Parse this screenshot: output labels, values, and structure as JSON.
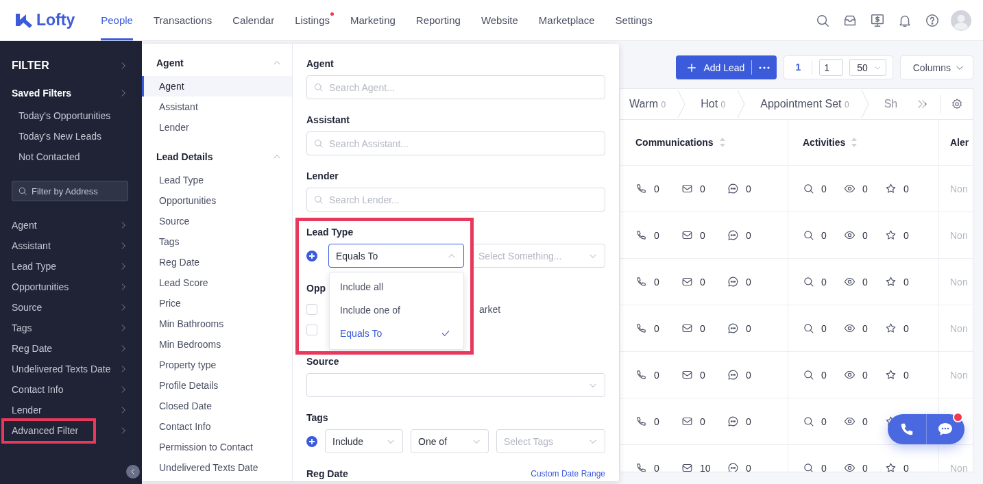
{
  "nav": {
    "logo": "Lofty",
    "items": [
      {
        "label": "People",
        "selected": true,
        "dot": false
      },
      {
        "label": "Transactions",
        "selected": false,
        "dot": false
      },
      {
        "label": "Calendar",
        "selected": false,
        "dot": false
      },
      {
        "label": "Listings",
        "selected": false,
        "dot": true
      },
      {
        "label": "Marketing",
        "selected": false,
        "dot": false
      },
      {
        "label": "Reporting",
        "selected": false,
        "dot": false
      },
      {
        "label": "Website",
        "selected": false,
        "dot": false
      },
      {
        "label": "Marketplace",
        "selected": false,
        "dot": false
      },
      {
        "label": "Settings",
        "selected": false,
        "dot": false
      }
    ]
  },
  "sidebar": {
    "title": "FILTER",
    "saved_filters": {
      "title": "Saved Filters",
      "items": [
        "Today's Opportunities",
        "Today's New Leads",
        "Not Contacted"
      ]
    },
    "address_search": {
      "placeholder": "Filter by Address"
    },
    "items": [
      {
        "label": "Agent",
        "highlighted": false
      },
      {
        "label": "Assistant",
        "highlighted": false
      },
      {
        "label": "Lead Type",
        "highlighted": false
      },
      {
        "label": "Opportunities",
        "highlighted": false
      },
      {
        "label": "Source",
        "highlighted": false
      },
      {
        "label": "Tags",
        "highlighted": false
      },
      {
        "label": "Reg Date",
        "highlighted": false
      },
      {
        "label": "Undelivered Texts Date",
        "highlighted": false
      },
      {
        "label": "Contact Info",
        "highlighted": false
      },
      {
        "label": "Lender",
        "highlighted": false
      },
      {
        "label": "Advanced Filter",
        "highlighted": true
      }
    ]
  },
  "filter_categories": [
    {
      "title": "Agent",
      "expanded": true,
      "items": [
        {
          "label": "Agent",
          "selected": true
        },
        {
          "label": "Assistant",
          "selected": false
        },
        {
          "label": "Lender",
          "selected": false
        }
      ]
    },
    {
      "title": "Lead Details",
      "expanded": true,
      "items": [
        {
          "label": "Lead Type",
          "selected": false
        },
        {
          "label": "Opportunities",
          "selected": false
        },
        {
          "label": "Source",
          "selected": false
        },
        {
          "label": "Tags",
          "selected": false
        },
        {
          "label": "Reg Date",
          "selected": false
        },
        {
          "label": "Lead Score",
          "selected": false
        },
        {
          "label": "Price",
          "selected": false
        },
        {
          "label": "Min Bathrooms",
          "selected": false
        },
        {
          "label": "Min Bedrooms",
          "selected": false
        },
        {
          "label": "Property type",
          "selected": false
        },
        {
          "label": "Profile Details",
          "selected": false
        },
        {
          "label": "Closed Date",
          "selected": false
        },
        {
          "label": "Contact Info",
          "selected": false
        },
        {
          "label": "Permission to Contact",
          "selected": false
        },
        {
          "label": "Undelivered Texts Date",
          "selected": false
        }
      ]
    }
  ],
  "filter_form": [
    {
      "kind": "search",
      "label": "Agent",
      "placeholder": "Search Agent..."
    },
    {
      "kind": "search",
      "label": "Assistant",
      "placeholder": "Search Assistant..."
    },
    {
      "kind": "search",
      "label": "Lender",
      "placeholder": "Search Lender..."
    },
    {
      "kind": "condition",
      "label": "Lead Type",
      "highlighted": true,
      "operator": {
        "value": "Equals To",
        "open": true,
        "options": [
          {
            "label": "Include all",
            "selected": false
          },
          {
            "label": "Include one of",
            "selected": false
          },
          {
            "label": "Equals To",
            "selected": true
          }
        ]
      },
      "target": {
        "placeholder": "Select Something..."
      }
    },
    {
      "kind": "checklist",
      "label": "Opp",
      "options": [
        {
          "label": "arket",
          "checked": false
        },
        {
          "checked": false
        }
      ]
    },
    {
      "kind": "select",
      "label": "Source"
    },
    {
      "kind": "tags",
      "label": "Tags",
      "selects": [
        {
          "value": "Include"
        },
        {
          "value": "One of"
        },
        {
          "placeholder": "Select Tags"
        }
      ]
    },
    {
      "kind": "date",
      "label": "Reg Date",
      "link": "Custom Date Range"
    }
  ],
  "toolbar": {
    "add_button": "Add Lead",
    "current_page": "1",
    "page_input": "1",
    "page_size": "50",
    "columns_button": "Columns"
  },
  "pipeline": [
    {
      "label": "Warm",
      "count": "0"
    },
    {
      "label": "Hot",
      "count": "0"
    },
    {
      "label": "Appointment Set",
      "count": "0"
    },
    {
      "label": "Sh"
    }
  ],
  "table": {
    "columns": [
      {
        "label": "Communications",
        "sortable": true
      },
      {
        "label": "Activities",
        "sortable": true
      },
      {
        "label": "Aler",
        "sortable": false
      }
    ],
    "rows": [
      {
        "calls": "0",
        "emails": "0",
        "texts": "0",
        "searches": "0",
        "views": "0",
        "favorites": "0",
        "alerts": "Non"
      },
      {
        "calls": "0",
        "emails": "0",
        "texts": "0",
        "searches": "0",
        "views": "0",
        "favorites": "0",
        "alerts": "Non"
      },
      {
        "calls": "0",
        "emails": "0",
        "texts": "0",
        "searches": "0",
        "views": "0",
        "favorites": "0",
        "alerts": "Non"
      },
      {
        "calls": "0",
        "emails": "0",
        "texts": "0",
        "searches": "0",
        "views": "0",
        "favorites": "0",
        "alerts": "Non"
      },
      {
        "calls": "0",
        "emails": "0",
        "texts": "0",
        "searches": "0",
        "views": "0",
        "favorites": "0",
        "alerts": "Non"
      },
      {
        "calls": "0",
        "emails": "0",
        "texts": "0",
        "searches": "0",
        "views": "0"
      },
      {
        "calls": "0",
        "emails": "10",
        "texts": "0",
        "searches": "0",
        "views": "0",
        "favorites": "0",
        "alerts": "Non"
      }
    ]
  },
  "chat_widget": {
    "unread": true
  }
}
